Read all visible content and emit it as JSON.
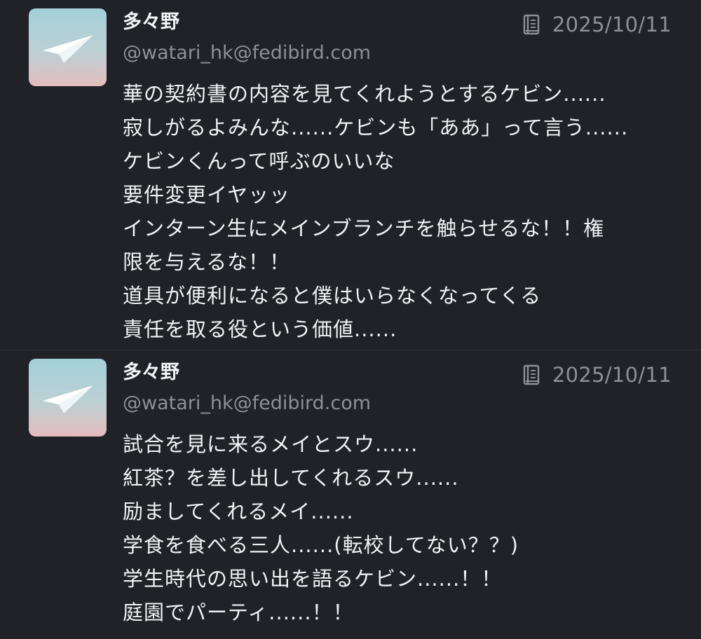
{
  "posts": [
    {
      "display_name": "多々野",
      "acct": "@watari_hk@fedibird.com",
      "date": "2025/10/11",
      "avatar_icon": "paper-plane-icon",
      "meta_icon": "book-icon",
      "lines": [
        "華の契約書の内容を見てくれようとするケビン......",
        "寂しがるよみんな......ケビンも「ああ」って言う......",
        "ケビンくんって呼ぶのいいな",
        "要件変更イヤッッ",
        "インターン生にメインブランチを触らせるな！！権",
        "限を与えるな！！",
        "道具が便利になると僕はいらなくなってくる",
        "責任を取る役という価値......"
      ]
    },
    {
      "display_name": "多々野",
      "acct": "@watari_hk@fedibird.com",
      "date": "2025/10/11",
      "avatar_icon": "paper-plane-icon",
      "meta_icon": "book-icon",
      "lines": [
        "試合を見に来るメイとスウ......",
        "紅茶？を差し出してくれるスウ......",
        "励ましてくれるメイ......",
        "学食を食べる三人......(転校してない？？)",
        "学生時代の思い出を語るケビン......！！",
        "庭園でパーティ......！！"
      ]
    }
  ],
  "colors": {
    "background": "#202227",
    "text": "#f2f2f4",
    "muted": "#8d9099",
    "divider": "#34373e"
  }
}
